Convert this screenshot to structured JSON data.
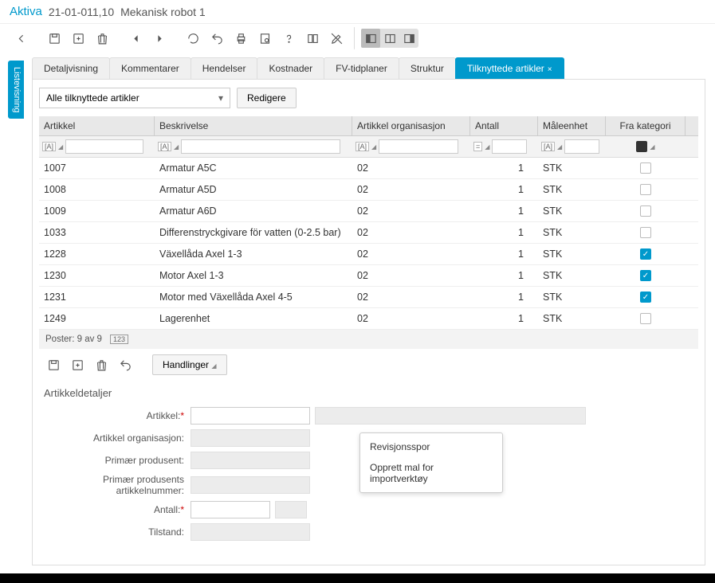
{
  "header": {
    "title": "Aktiva",
    "code": "21-01-011,10",
    "description": "Mekanisk robot 1"
  },
  "sideTab": "Listevisning",
  "tabs": [
    {
      "label": "Detaljvisning"
    },
    {
      "label": "Kommentarer"
    },
    {
      "label": "Hendelser"
    },
    {
      "label": "Kostnader"
    },
    {
      "label": "FV-tidplaner"
    },
    {
      "label": "Struktur"
    },
    {
      "label": "Tilknyttede artikler",
      "active": true,
      "closable": true
    }
  ],
  "filter": {
    "selected": "Alle tilknyttede artikler",
    "editButton": "Redigere"
  },
  "grid": {
    "columns": {
      "artikkel": "Artikkel",
      "beskrivelse": "Beskrivelse",
      "org": "Artikkel organisasjon",
      "antall": "Antall",
      "maalenhet": "Måleenhet",
      "fraKategori": "Fra kategori"
    },
    "rows": [
      {
        "art": "1007",
        "besk": "Armatur A5C",
        "org": "02",
        "antall": "1",
        "maal": "STK",
        "kat": false
      },
      {
        "art": "1008",
        "besk": "Armatur A5D",
        "org": "02",
        "antall": "1",
        "maal": "STK",
        "kat": false
      },
      {
        "art": "1009",
        "besk": "Armatur A6D",
        "org": "02",
        "antall": "1",
        "maal": "STK",
        "kat": false
      },
      {
        "art": "1033",
        "besk": "Differenstryckgivare för vatten (0-2.5 bar)",
        "org": "02",
        "antall": "1",
        "maal": "STK",
        "kat": false
      },
      {
        "art": "1228",
        "besk": "Växellåda Axel 1-3",
        "org": "02",
        "antall": "1",
        "maal": "STK",
        "kat": true
      },
      {
        "art": "1230",
        "besk": "Motor Axel 1-3",
        "org": "02",
        "antall": "1",
        "maal": "STK",
        "kat": true
      },
      {
        "art": "1231",
        "besk": "Motor med Växellåda Axel 4-5",
        "org": "02",
        "antall": "1",
        "maal": "STK",
        "kat": true
      },
      {
        "art": "1249",
        "besk": "Lagerenhet",
        "org": "02",
        "antall": "1",
        "maal": "STK",
        "kat": false
      }
    ],
    "footer": {
      "poster": "Poster: 9 av 9",
      "badge": "123"
    }
  },
  "lowerToolbar": {
    "actions": "Handlinger"
  },
  "detailsTitle": "Artikkeldetaljer",
  "details": {
    "labels": {
      "artikkel": "Artikkel:",
      "org": "Artikkel organisasjon:",
      "produsent": "Primær produsent:",
      "produsentNr": "Primær produsents artikkelnummer:",
      "antall": "Antall:",
      "tilstand": "Tilstand:"
    }
  },
  "popup": {
    "revisjonsspor": "Revisjonsspor",
    "opprettMal": "Opprett mal for importverktøy"
  }
}
